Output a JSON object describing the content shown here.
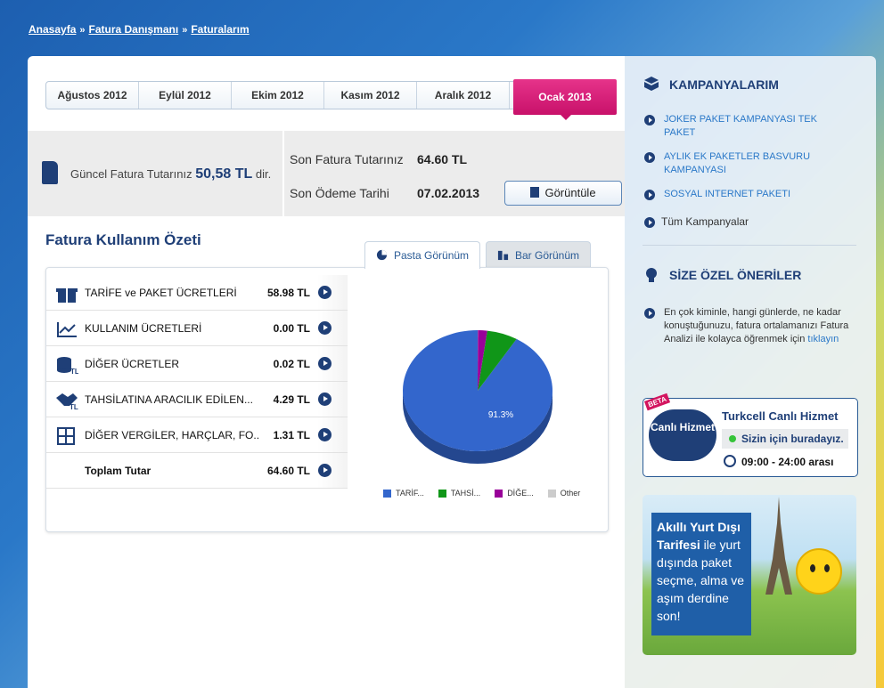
{
  "breadcrumb": [
    "Anasayfa",
    "Fatura Danışmanı",
    "Faturalarım"
  ],
  "breadcrumb_sep": "»",
  "months": [
    "Ağustos 2012",
    "Eylül 2012",
    "Ekim 2012",
    "Kasım 2012",
    "Aralık 2012",
    "Ocak 2013"
  ],
  "active_month": "Ocak 2013",
  "summary": {
    "current_prefix": "Güncel Fatura Tutarınız",
    "current_amount": "50,58 TL",
    "current_suffix": "dir.",
    "last_invoice_label": "Son Fatura Tutarınız",
    "last_invoice_value": "64.60 TL",
    "due_label": "Son Ödeme Tarihi",
    "due_value": "07.02.2013",
    "view_button": "Görüntüle"
  },
  "usage": {
    "title": "Fatura Kullanım Özeti",
    "tab_pie": "Pasta Görünüm",
    "tab_bar": "Bar Görünüm",
    "rows": [
      {
        "label": "TARİFE ve PAKET ÜCRETLERİ",
        "value": "58.98 TL",
        "icon": "gift-icon"
      },
      {
        "label": "KULLANIM ÜCRETLERİ",
        "value": "0.00 TL",
        "icon": "line-chart-icon"
      },
      {
        "label": "DİĞER ÜCRETLER",
        "value": "0.02 TL",
        "icon": "coins-icon"
      },
      {
        "label": "TAHSİLATINA ARACILIK EDİLEN...",
        "value": "4.29 TL",
        "icon": "handshake-icon"
      },
      {
        "label": "DİĞER VERGİLER, HARÇLAR, FO...",
        "value": "1.31 TL",
        "icon": "calculator-icon"
      },
      {
        "label": "Toplam Tutar",
        "value": "64.60 TL",
        "icon": ""
      }
    ]
  },
  "chart_data": {
    "type": "pie",
    "slices": [
      {
        "label": "TARİF...",
        "value": 58.98,
        "color": "#3366cc"
      },
      {
        "label": "TAHSİ...",
        "value": 4.29,
        "color": "#109618"
      },
      {
        "label": "DİĞE...",
        "value": 1.31,
        "color": "#990099"
      },
      {
        "label": "Other",
        "value": 0.02,
        "color": "#cccccc"
      }
    ],
    "data_labels": [
      "91.3%"
    ],
    "legend_position": "bottom"
  },
  "sidebar": {
    "campaigns_title": "KAMPANYALARIM",
    "campaigns": [
      "JOKER PAKET KAMPANYASI TEK PAKET",
      "AYLIK EK PAKETLER BASVURU KAMPANYASI",
      "SOSYAL INTERNET PAKETI"
    ],
    "all_campaigns": "Tüm Kampanyalar",
    "offers_title": "SİZE ÖZEL ÖNERİLER",
    "offer_text": "En çok kiminle, hangi günlerde, ne kadar konuştuğunuzu, fatura ortalamanızı Fatura Analizi ile kolayca öğrenmek için",
    "offer_link": "tıklayın",
    "live": {
      "beta": "BETA",
      "bubble": "Canlı Hizmet",
      "title": "Turkcell Canlı Hizmet",
      "status": "Sizin için buradayız.",
      "hours": "09:00 - 24:00 arası"
    },
    "promo": {
      "bold": "Akıllı Yurt Dışı Tarifesi",
      "text": "ile yurt dışında paket seçme, alma ve aşım derdine son!"
    }
  }
}
